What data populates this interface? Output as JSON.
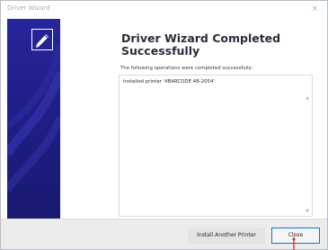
{
  "window": {
    "title": "Driver Wizard",
    "close_glyph": "×"
  },
  "sidebar": {
    "logo_icon": "wizard-pen-icon",
    "background_color": "#1e1e88"
  },
  "main": {
    "heading": "Driver Wizard Completed Successfully",
    "subtext": "The following operations were completed successfully:",
    "log_lines": [
      "Installed printer '4BARCODE 4B-2054'."
    ],
    "scroll_up_glyph": "▲",
    "scroll_down_glyph": "▼"
  },
  "footer": {
    "install_another_label": "Install Another Printer",
    "close_label": "Close"
  },
  "colors": {
    "accent_focus_border": "#0a74d6",
    "annotation_arrow": "#e3342f"
  }
}
